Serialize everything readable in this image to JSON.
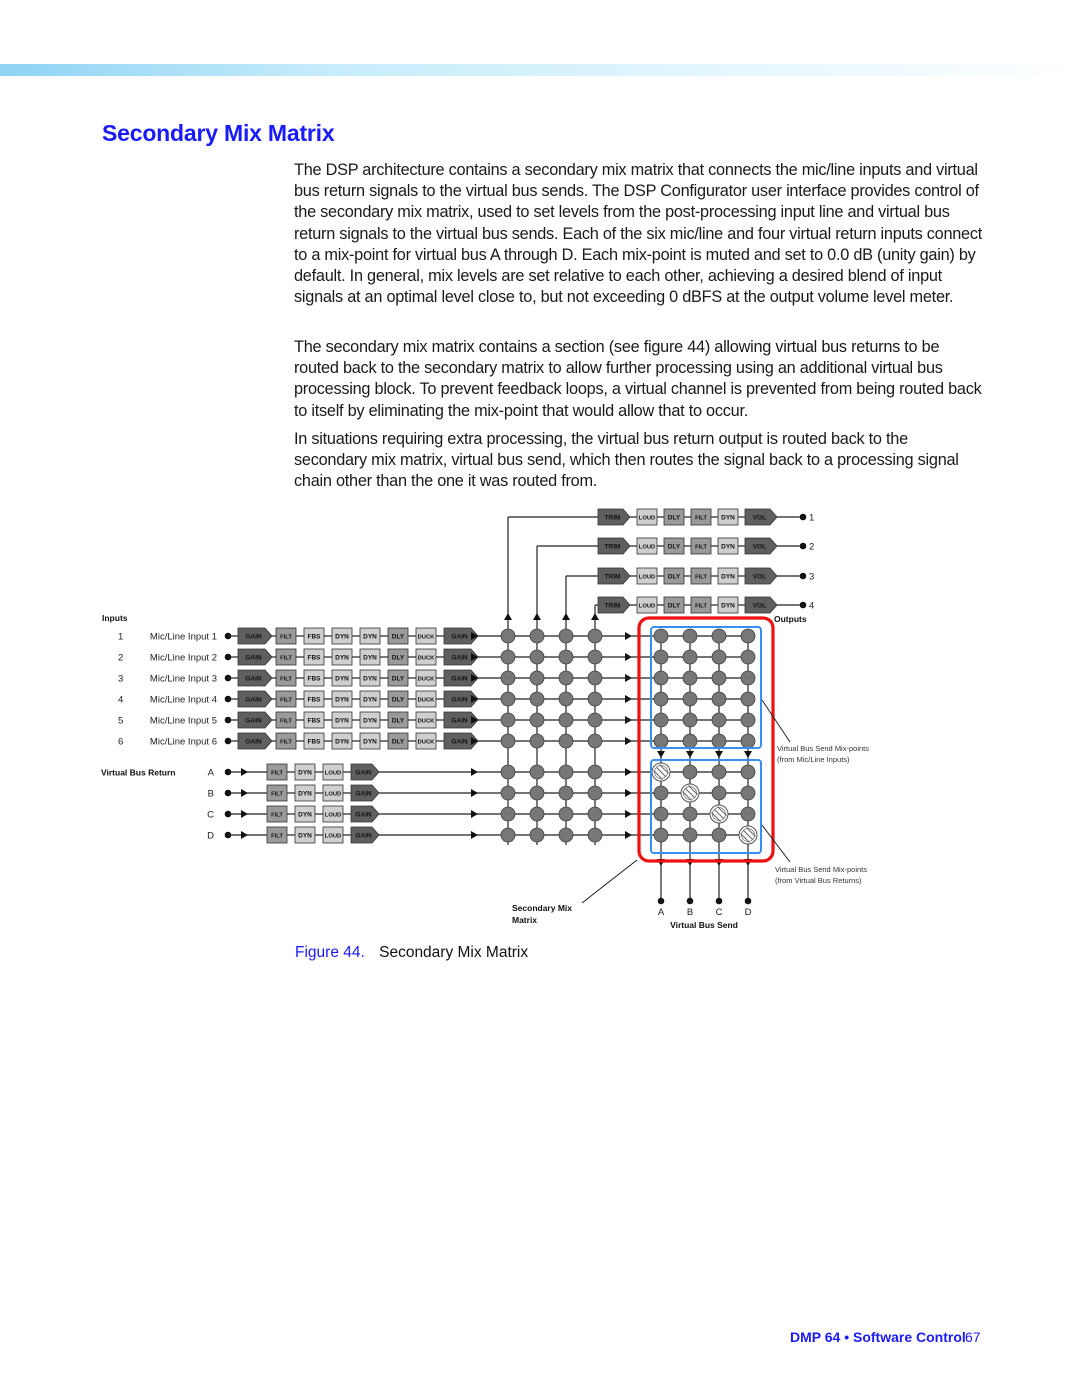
{
  "header": {
    "title": "Secondary Mix Matrix"
  },
  "paragraphs": [
    "The DSP architecture contains a secondary mix matrix that connects the mic/line inputs and virtual bus return signals to the virtual bus sends. The DSP Configurator user interface provides control of the secondary mix matrix, used to set levels from the post-processing input line and virtual bus return signals to the virtual bus sends. Each of the six mic/line and four virtual return inputs connect to a mix-point for virtual bus A through D. Each mix-point is muted and set to 0.0 dB (unity gain) by default. In general, mix levels are set relative to each other, achieving a desired blend of input signals at an optimal level close to, but not exceeding 0 dBFS at the output volume level meter.",
    "The secondary mix matrix contains a section (see figure 44) allowing virtual bus returns to be routed back to the secondary matrix to allow further processing using an additional virtual bus processing block. To prevent feedback loops, a virtual channel is prevented from being routed back to itself by eliminating the mix-point that would allow that to occur.",
    "In situations requiring extra processing, the virtual bus return output is routed back to the secondary mix matrix, virtual bus send, which then routes the signal back to a processing signal chain other than the one it was routed from."
  ],
  "diagram": {
    "inputs_label": "Inputs",
    "outputs_label": "Outputs",
    "mic_inputs": [
      {
        "num": "1",
        "label": "Mic/Line Input 1"
      },
      {
        "num": "2",
        "label": "Mic/Line Input 2"
      },
      {
        "num": "3",
        "label": "Mic/Line Input 3"
      },
      {
        "num": "4",
        "label": "Mic/Line Input 4"
      },
      {
        "num": "5",
        "label": "Mic/Line Input 5"
      },
      {
        "num": "6",
        "label": "Mic/Line Input 6"
      }
    ],
    "input_chain": [
      "GAIN",
      "FILT",
      "FBS",
      "DYN",
      "DYN",
      "DLY",
      "DUCK",
      "GAIN"
    ],
    "virtual_return_label": "Virtual Bus Return",
    "virtual_returns": [
      "A",
      "B",
      "C",
      "D"
    ],
    "return_chain": [
      "FILT",
      "DYN",
      "LOUD",
      "GAIN"
    ],
    "outputs": [
      "1",
      "2",
      "3",
      "4"
    ],
    "output_chain": [
      "TRIM",
      "LOUD",
      "DLY",
      "FILT",
      "DYN",
      "VOL"
    ],
    "bus_sends": [
      "A",
      "B",
      "C",
      "D"
    ],
    "bus_send_label": "Virtual Bus Send",
    "matrix_label": "Secondary Mix Matrix",
    "annot_mic": [
      "Virtual Bus Send Mix-points",
      "(from Mic/Line Inputs)"
    ],
    "annot_vbr": [
      "Virtual Bus Send Mix-points",
      "(from Virtual Bus Returns)"
    ],
    "disabled_mixpoints": [
      [
        0,
        0
      ],
      [
        1,
        1
      ],
      [
        2,
        2
      ],
      [
        3,
        3
      ]
    ],
    "colors": {
      "dark_block": "#5f5f5f",
      "mid_block": "#9a9a9a",
      "light_block": "#cfcfcf",
      "node": "#777777",
      "secondary_matrix_outline": "#ee1111",
      "section_outline": "#3a8ef0"
    }
  },
  "caption": {
    "number": "Figure 44.",
    "text": "Secondary Mix Matrix"
  },
  "footer": {
    "doc": "DMP 64 • Software Control",
    "page": "67"
  }
}
